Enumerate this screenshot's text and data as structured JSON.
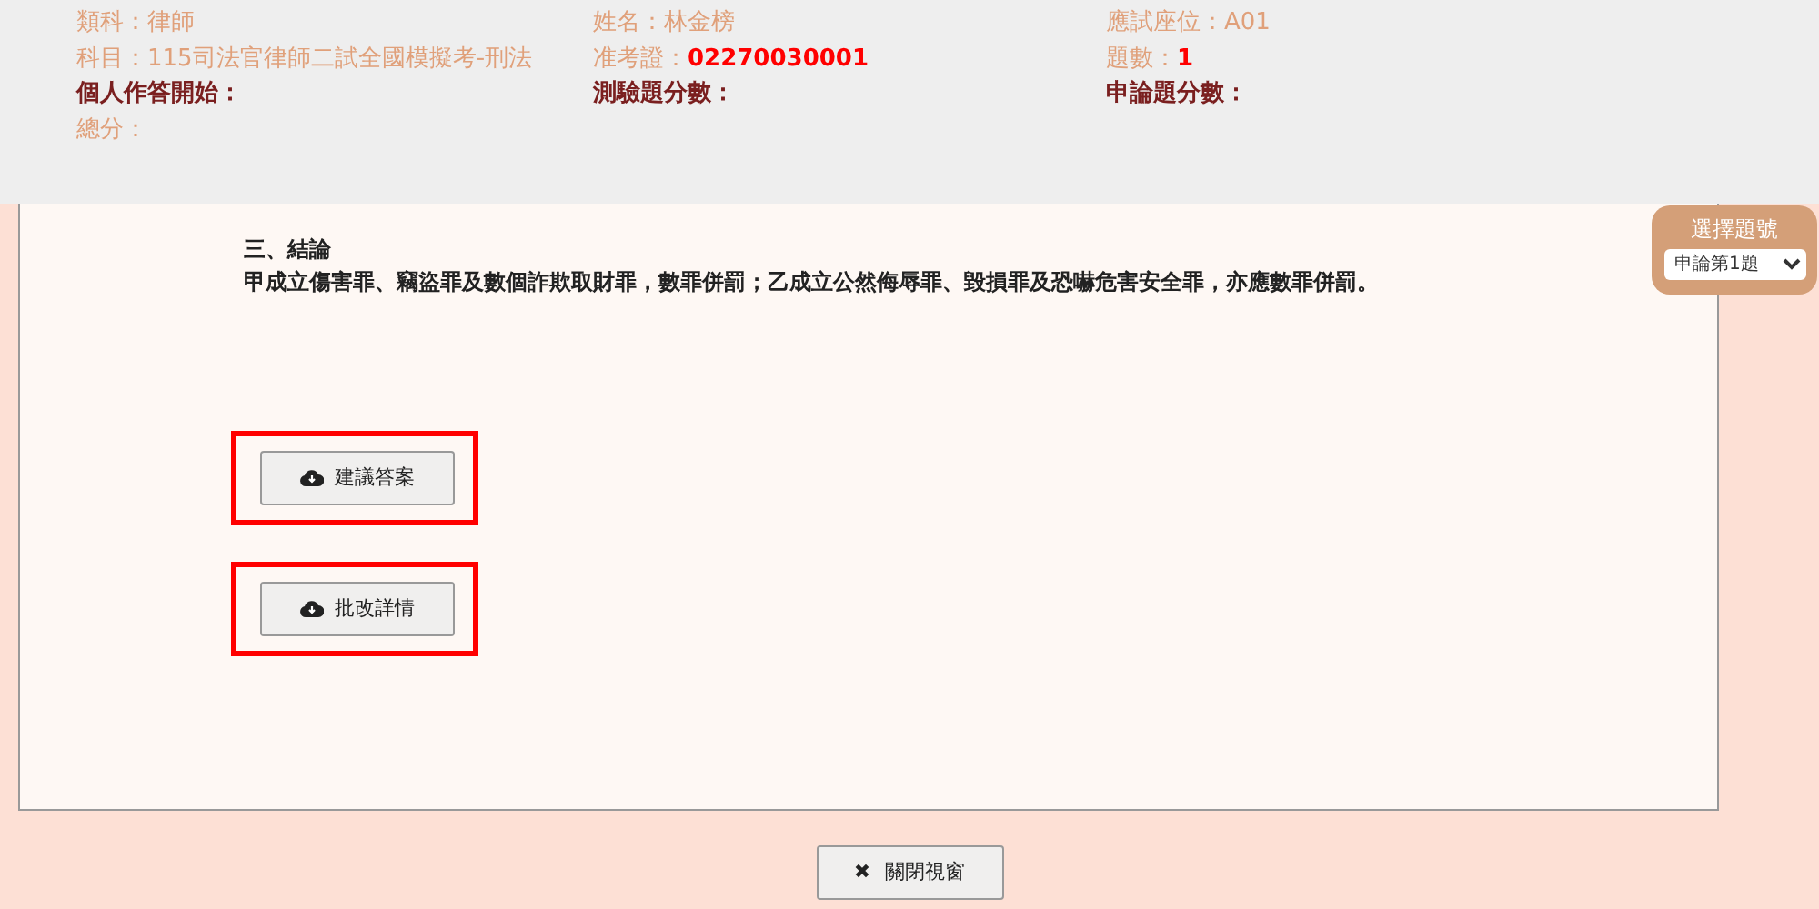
{
  "header": {
    "fields": [
      {
        "label": "類科：",
        "value": "律師",
        "kind": "info",
        "highlight": false
      },
      {
        "label": "姓名：",
        "value": "林金榜",
        "kind": "info",
        "highlight": false
      },
      {
        "label": "應試座位：",
        "value": "A01",
        "kind": "info",
        "highlight": false
      },
      {
        "label": "科目：",
        "value": "115司法官律師二試全國模擬考-刑法",
        "kind": "info",
        "highlight": false
      },
      {
        "label": "准考證：",
        "value": "02270030001",
        "kind": "info",
        "highlight": true
      },
      {
        "label": "題數：",
        "value": "1",
        "kind": "info",
        "highlight": true
      },
      {
        "label": "個人作答開始：",
        "kind": "score"
      },
      {
        "label": "測驗題分數：",
        "kind": "score"
      },
      {
        "label": "申論題分數：",
        "kind": "score"
      },
      {
        "label": "總分：",
        "kind": "info"
      }
    ]
  },
  "content": {
    "heading": "三、結論",
    "text": "甲成立傷害罪、竊盜罪及數個詐欺取財罪，數罪併罰；乙成立公然侮辱罪、毀損罪及恐嚇危害安全罪，亦應數罪併罰。"
  },
  "actions": [
    {
      "label": "建議答案",
      "highlighted": true
    },
    {
      "label": "批改詳情",
      "highlighted": true
    }
  ],
  "question_picker": {
    "title": "選擇題號",
    "value": "申論第1題"
  },
  "close_button": {
    "icon": "✖",
    "label": "關閉視窗"
  }
}
